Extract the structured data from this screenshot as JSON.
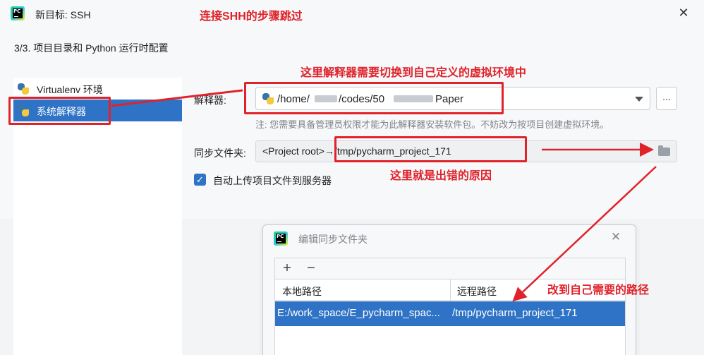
{
  "window": {
    "title": "新目标: SSH",
    "close_glyph": "✕",
    "step_header": "3/3. 项目目录和 Python 运行时配置"
  },
  "sidebar": {
    "items": [
      {
        "label": "Virtualenv 环境",
        "selected": false
      },
      {
        "label": "系统解释器",
        "selected": true
      }
    ]
  },
  "interpreter": {
    "label": "解释器:",
    "path_parts": [
      "/home/",
      "/codes/50",
      "Paper"
    ],
    "browse_label": "...",
    "note_prefix": "注:",
    "note_text": " 您需要具备管理员权限才能为此解释器安装软件包。不妨改为按项目创建虚拟环境。"
  },
  "sync": {
    "label": "同步文件夹:",
    "value": "<Project root>→/tmp/pycharm_project_171"
  },
  "auto_upload": {
    "checked": true,
    "label": "自动上传项目文件到服务器"
  },
  "sub_dialog": {
    "title": "编辑同步文件夹",
    "close_glyph": "✕",
    "add_glyph": "+",
    "remove_glyph": "−",
    "columns": [
      "本地路径",
      "远程路径"
    ],
    "rows": [
      {
        "local": "E:/work_space/E_pycharm_spac...",
        "remote": "/tmp/pycharm_project_171"
      }
    ]
  },
  "annotations": {
    "top": "连接SHH的步骤跳过",
    "interp": "这里解释器需要切换到自己定义的虚拟环境中",
    "cause": "这里就是出错的原因",
    "fix": "改到自己需要的路径",
    "color": "#e0222a"
  },
  "colors": {
    "accent": "#2f73c6",
    "background": "#f7f8fa"
  }
}
